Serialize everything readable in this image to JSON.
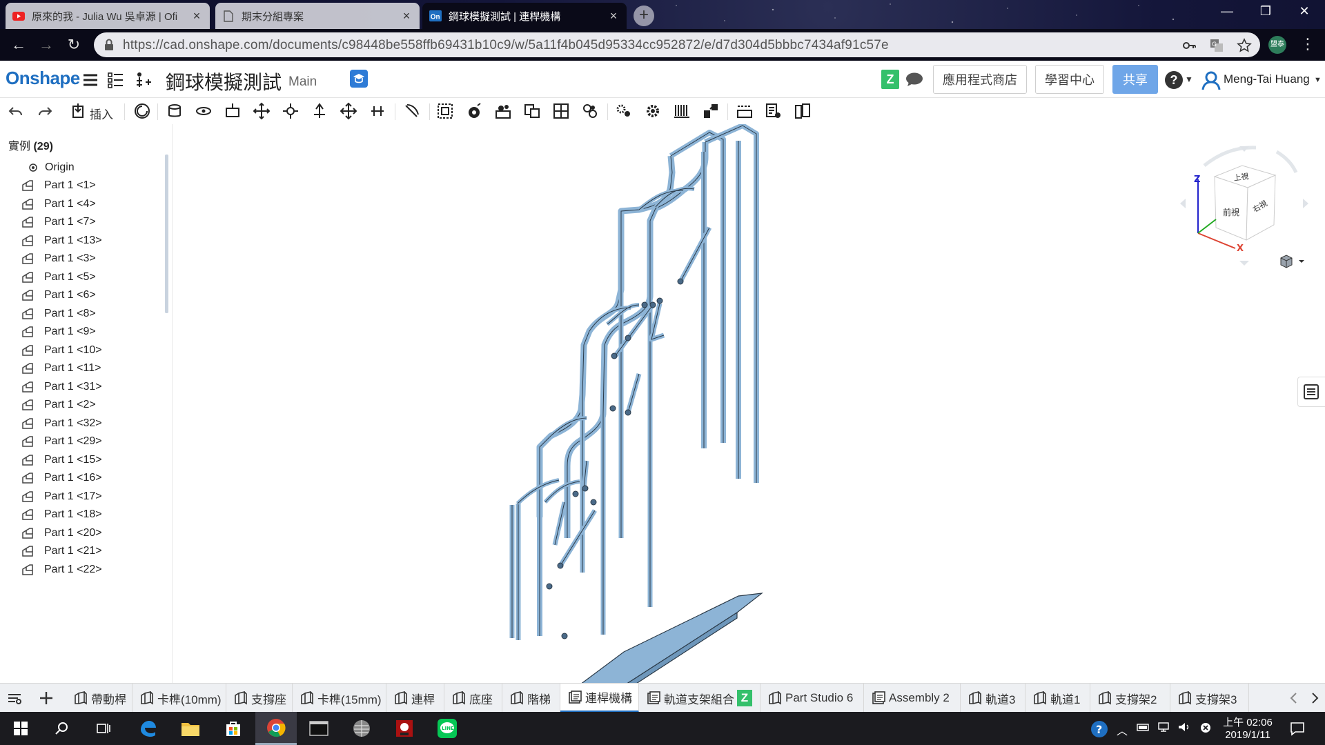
{
  "browser": {
    "tabs": [
      {
        "title": "原來的我 - Julia Wu 吳卓源 | Ofi",
        "favicon": "youtube-icon"
      },
      {
        "title": "期末分組專案",
        "favicon": "document-icon"
      },
      {
        "title": "鋼球模擬測試 | 連桿機構",
        "favicon": "onshape-icon"
      }
    ],
    "url": "https://cad.onshape.com/documents/c98448be558ffb69431b10c9/w/5a11f4b045d95334cc952872/e/d7d304d5bbbc7434af91c57e",
    "profile_label": "盟泰"
  },
  "app": {
    "logo": "Onshape",
    "document_title": "鋼球模擬測試",
    "branch": "Main",
    "app_store_label": "應用程式商店",
    "learning_center_label": "學習中心",
    "share_label": "共享",
    "user_name": "Meng-Tai Huang",
    "z_badge": "Z"
  },
  "toolbar": {
    "insert_label": "插入"
  },
  "instances": {
    "header_label": "實例",
    "count": "(29)",
    "origin_label": "Origin",
    "items": [
      "Part 1 <1>",
      "Part 1 <4>",
      "Part 1 <7>",
      "Part 1 <13>",
      "Part 1 <3>",
      "Part 1 <5>",
      "Part 1 <6>",
      "Part 1 <8>",
      "Part 1 <9>",
      "Part 1 <10>",
      "Part 1 <11>",
      "Part 1 <31>",
      "Part 1 <2>",
      "Part 1 <32>",
      "Part 1 <29>",
      "Part 1 <15>",
      "Part 1 <16>",
      "Part 1 <17>",
      "Part 1 <18>",
      "Part 1 <20>",
      "Part 1 <21>",
      "Part 1 <22>"
    ]
  },
  "viewcube": {
    "top_label": "上視",
    "front_label": "前視",
    "right_label": "右視",
    "z_axis": "Z",
    "x_axis": "X"
  },
  "bottom_tabs": [
    {
      "label": "帶動桿",
      "type": "part-studio"
    },
    {
      "label": "卡榫(10mm)",
      "type": "part-studio"
    },
    {
      "label": "支撐座",
      "type": "part-studio"
    },
    {
      "label": "卡榫(15mm)",
      "type": "part-studio"
    },
    {
      "label": "連桿",
      "type": "part-studio"
    },
    {
      "label": "底座",
      "type": "part-studio"
    },
    {
      "label": "階梯",
      "type": "part-studio"
    },
    {
      "label": "連桿機構",
      "type": "assembly",
      "active": true
    },
    {
      "label": "軌道支架組合",
      "type": "assembly",
      "badge": "Z"
    },
    {
      "label": "Part Studio 6",
      "type": "part-studio"
    },
    {
      "label": "Assembly 2",
      "type": "assembly"
    },
    {
      "label": "軌道3",
      "type": "part-studio"
    },
    {
      "label": "軌道1",
      "type": "part-studio"
    },
    {
      "label": "支撐架2",
      "type": "part-studio"
    },
    {
      "label": "支撐架3",
      "type": "part-studio"
    }
  ],
  "taskbar": {
    "time": "上午 02:06",
    "date": "2019/1/11"
  },
  "colors": {
    "onshape_blue": "#1f6fc1",
    "share_button": "#6fa6e8",
    "model_fill": "#8db4d6",
    "model_edge": "#2b3a48",
    "z_badge": "#34c06b"
  }
}
